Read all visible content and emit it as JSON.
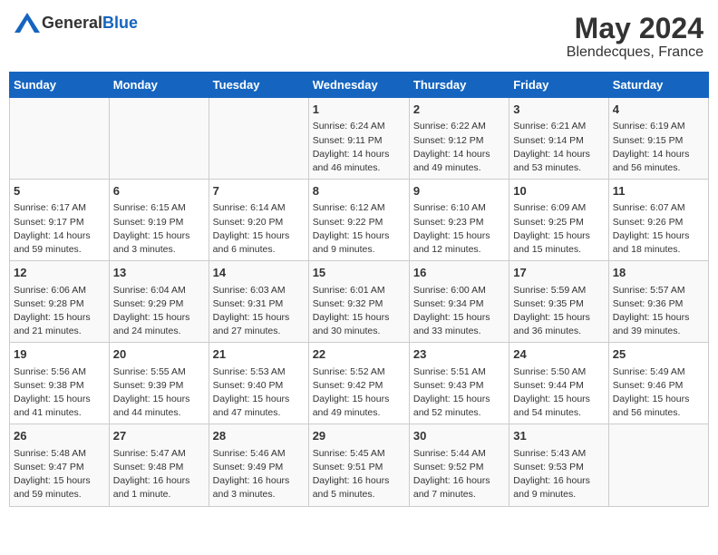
{
  "header": {
    "logo_general": "General",
    "logo_blue": "Blue",
    "title": "May 2024",
    "subtitle": "Blendecques, France"
  },
  "weekdays": [
    "Sunday",
    "Monday",
    "Tuesday",
    "Wednesday",
    "Thursday",
    "Friday",
    "Saturday"
  ],
  "weeks": [
    {
      "days": [
        {
          "num": "",
          "info": ""
        },
        {
          "num": "",
          "info": ""
        },
        {
          "num": "",
          "info": ""
        },
        {
          "num": "1",
          "info": "Sunrise: 6:24 AM\nSunset: 9:11 PM\nDaylight: 14 hours\nand 46 minutes."
        },
        {
          "num": "2",
          "info": "Sunrise: 6:22 AM\nSunset: 9:12 PM\nDaylight: 14 hours\nand 49 minutes."
        },
        {
          "num": "3",
          "info": "Sunrise: 6:21 AM\nSunset: 9:14 PM\nDaylight: 14 hours\nand 53 minutes."
        },
        {
          "num": "4",
          "info": "Sunrise: 6:19 AM\nSunset: 9:15 PM\nDaylight: 14 hours\nand 56 minutes."
        }
      ]
    },
    {
      "days": [
        {
          "num": "5",
          "info": "Sunrise: 6:17 AM\nSunset: 9:17 PM\nDaylight: 14 hours\nand 59 minutes."
        },
        {
          "num": "6",
          "info": "Sunrise: 6:15 AM\nSunset: 9:19 PM\nDaylight: 15 hours\nand 3 minutes."
        },
        {
          "num": "7",
          "info": "Sunrise: 6:14 AM\nSunset: 9:20 PM\nDaylight: 15 hours\nand 6 minutes."
        },
        {
          "num": "8",
          "info": "Sunrise: 6:12 AM\nSunset: 9:22 PM\nDaylight: 15 hours\nand 9 minutes."
        },
        {
          "num": "9",
          "info": "Sunrise: 6:10 AM\nSunset: 9:23 PM\nDaylight: 15 hours\nand 12 minutes."
        },
        {
          "num": "10",
          "info": "Sunrise: 6:09 AM\nSunset: 9:25 PM\nDaylight: 15 hours\nand 15 minutes."
        },
        {
          "num": "11",
          "info": "Sunrise: 6:07 AM\nSunset: 9:26 PM\nDaylight: 15 hours\nand 18 minutes."
        }
      ]
    },
    {
      "days": [
        {
          "num": "12",
          "info": "Sunrise: 6:06 AM\nSunset: 9:28 PM\nDaylight: 15 hours\nand 21 minutes."
        },
        {
          "num": "13",
          "info": "Sunrise: 6:04 AM\nSunset: 9:29 PM\nDaylight: 15 hours\nand 24 minutes."
        },
        {
          "num": "14",
          "info": "Sunrise: 6:03 AM\nSunset: 9:31 PM\nDaylight: 15 hours\nand 27 minutes."
        },
        {
          "num": "15",
          "info": "Sunrise: 6:01 AM\nSunset: 9:32 PM\nDaylight: 15 hours\nand 30 minutes."
        },
        {
          "num": "16",
          "info": "Sunrise: 6:00 AM\nSunset: 9:34 PM\nDaylight: 15 hours\nand 33 minutes."
        },
        {
          "num": "17",
          "info": "Sunrise: 5:59 AM\nSunset: 9:35 PM\nDaylight: 15 hours\nand 36 minutes."
        },
        {
          "num": "18",
          "info": "Sunrise: 5:57 AM\nSunset: 9:36 PM\nDaylight: 15 hours\nand 39 minutes."
        }
      ]
    },
    {
      "days": [
        {
          "num": "19",
          "info": "Sunrise: 5:56 AM\nSunset: 9:38 PM\nDaylight: 15 hours\nand 41 minutes."
        },
        {
          "num": "20",
          "info": "Sunrise: 5:55 AM\nSunset: 9:39 PM\nDaylight: 15 hours\nand 44 minutes."
        },
        {
          "num": "21",
          "info": "Sunrise: 5:53 AM\nSunset: 9:40 PM\nDaylight: 15 hours\nand 47 minutes."
        },
        {
          "num": "22",
          "info": "Sunrise: 5:52 AM\nSunset: 9:42 PM\nDaylight: 15 hours\nand 49 minutes."
        },
        {
          "num": "23",
          "info": "Sunrise: 5:51 AM\nSunset: 9:43 PM\nDaylight: 15 hours\nand 52 minutes."
        },
        {
          "num": "24",
          "info": "Sunrise: 5:50 AM\nSunset: 9:44 PM\nDaylight: 15 hours\nand 54 minutes."
        },
        {
          "num": "25",
          "info": "Sunrise: 5:49 AM\nSunset: 9:46 PM\nDaylight: 15 hours\nand 56 minutes."
        }
      ]
    },
    {
      "days": [
        {
          "num": "26",
          "info": "Sunrise: 5:48 AM\nSunset: 9:47 PM\nDaylight: 15 hours\nand 59 minutes."
        },
        {
          "num": "27",
          "info": "Sunrise: 5:47 AM\nSunset: 9:48 PM\nDaylight: 16 hours\nand 1 minute."
        },
        {
          "num": "28",
          "info": "Sunrise: 5:46 AM\nSunset: 9:49 PM\nDaylight: 16 hours\nand 3 minutes."
        },
        {
          "num": "29",
          "info": "Sunrise: 5:45 AM\nSunset: 9:51 PM\nDaylight: 16 hours\nand 5 minutes."
        },
        {
          "num": "30",
          "info": "Sunrise: 5:44 AM\nSunset: 9:52 PM\nDaylight: 16 hours\nand 7 minutes."
        },
        {
          "num": "31",
          "info": "Sunrise: 5:43 AM\nSunset: 9:53 PM\nDaylight: 16 hours\nand 9 minutes."
        },
        {
          "num": "",
          "info": ""
        }
      ]
    }
  ]
}
